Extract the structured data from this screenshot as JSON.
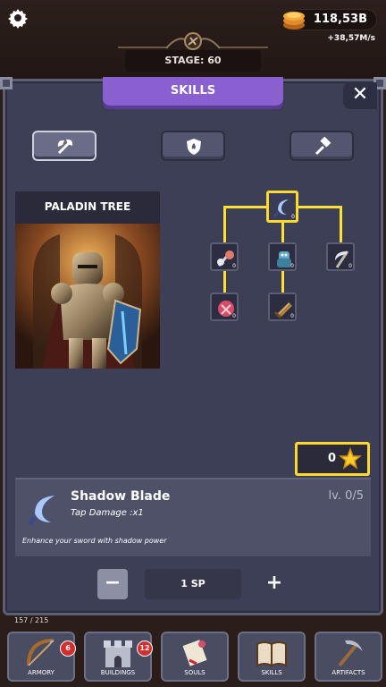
{
  "header": {
    "gold": "118,53B",
    "gold_rate": "+38,57M/s",
    "stage_label": "STAGE: 60"
  },
  "panel": {
    "tab_title": "SKILLS",
    "close_glyph": "✕",
    "categories": [
      {
        "icon": "axe-icon",
        "active": true
      },
      {
        "icon": "fire-shield-icon",
        "active": false
      },
      {
        "icon": "hammer-icon",
        "active": false
      }
    ]
  },
  "tree": {
    "title": "PALADIN TREE",
    "nodes": [
      {
        "name": "shadow-blade",
        "level": "0"
      },
      {
        "name": "sword-mastery",
        "level": "0"
      },
      {
        "name": "guardian",
        "level": "0"
      },
      {
        "name": "scythe",
        "level": "0"
      },
      {
        "name": "rage",
        "level": "0"
      },
      {
        "name": "daggers",
        "level": "0"
      }
    ],
    "skill_points": "0"
  },
  "detail": {
    "name": "Shadow Blade",
    "effect": "Tap Damage :x1",
    "level": "lv. 0/5",
    "description": "Enhance your sword with shadow power",
    "minus_glyph": "−",
    "cost": "1 SP",
    "plus_glyph": "+"
  },
  "bottom": {
    "count": "157 / 215",
    "nav": [
      {
        "label": "ARMORY",
        "badge": "6"
      },
      {
        "label": "BUILDINGS",
        "badge": "12"
      },
      {
        "label": "SOULS"
      },
      {
        "label": "SKILLS"
      },
      {
        "label": "ARTIFACTS"
      }
    ]
  },
  "colors": {
    "accent": "#8a5fd0",
    "highlight": "#ffd92e",
    "panel": "#3d3f57"
  }
}
